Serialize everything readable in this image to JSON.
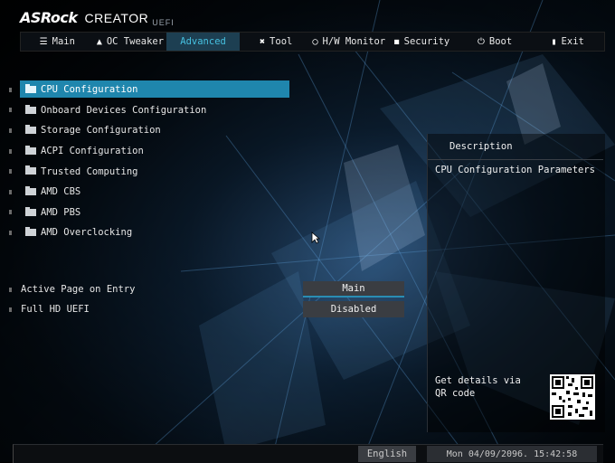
{
  "header": {
    "brand": "ASRock",
    "product": "CREATOR",
    "suffix": "UEFI"
  },
  "tabs": [
    {
      "label": "Main",
      "icon": "list-icon"
    },
    {
      "label": "OC Tweaker",
      "icon": "flame-icon"
    },
    {
      "label": "Advanced",
      "icon": "",
      "active": true
    },
    {
      "label": "Tool",
      "icon": "tools-icon"
    },
    {
      "label": "H/W Monitor",
      "icon": "gauge-icon"
    },
    {
      "label": "Security",
      "icon": "shield-icon"
    },
    {
      "label": "Boot",
      "icon": "power-icon"
    },
    {
      "label": "Exit",
      "icon": "door-icon"
    }
  ],
  "menu": [
    {
      "label": "CPU Configuration",
      "selected": true
    },
    {
      "label": "Onboard Devices Configuration"
    },
    {
      "label": "Storage Configuration"
    },
    {
      "label": "ACPI Configuration"
    },
    {
      "label": "Trusted Computing"
    },
    {
      "label": "AMD CBS"
    },
    {
      "label": "AMD PBS"
    },
    {
      "label": "AMD Overclocking"
    }
  ],
  "settings": [
    {
      "label": "Active Page on Entry",
      "value": "Main"
    },
    {
      "label": "Full HD UEFI",
      "value": "Disabled"
    }
  ],
  "description": {
    "title": "Description",
    "text": "CPU Configuration Parameters",
    "qr_text": "Get details via QR code"
  },
  "footer": {
    "language": "English",
    "datetime": "Mon 04/09/2096. 15:42:58"
  },
  "colors": {
    "accent": "#1f86ad",
    "active_tab_text": "#46c0e0"
  }
}
